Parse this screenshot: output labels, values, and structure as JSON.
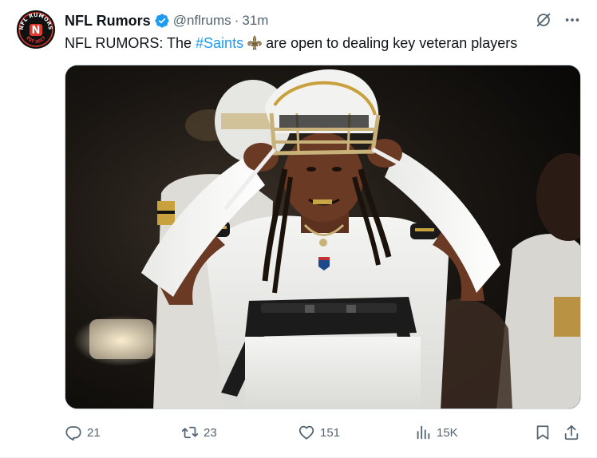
{
  "author": {
    "display_name": "NFL Rumors",
    "handle": "@nflrums",
    "separator": "·",
    "time": "31m",
    "avatar_text_top": "NFL RUMORS",
    "avatar_letter": "N",
    "avatar_text_bottom": "EST 2017",
    "verified": true
  },
  "tweet": {
    "text_before": "NFL RUMORS: The",
    "hashtag": "#Saints",
    "emoji_icon": "fleur-de-lis-icon",
    "text_after": "are open to dealing key veteran players"
  },
  "media": {
    "description_icon": "photo"
  },
  "actions": {
    "replies": "21",
    "retweets": "23",
    "likes": "151",
    "views": "15K"
  },
  "colors": {
    "accent": "#1d9bf0",
    "verified": "#1d9bf0",
    "muted_text": "#536471",
    "primary_text": "#0f1419",
    "avatar_red": "#e03a2f"
  }
}
